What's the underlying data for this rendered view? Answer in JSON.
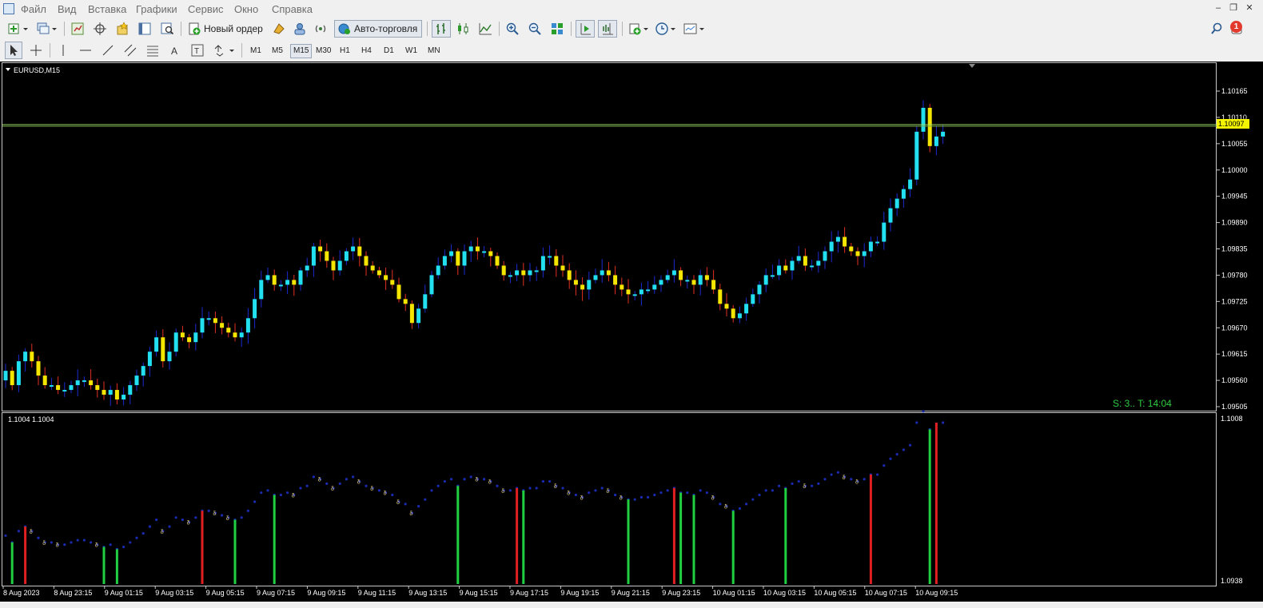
{
  "menu": {
    "items": [
      "Файл",
      "Вид",
      "Вставка",
      "Графики",
      "Сервис",
      "Окно",
      "Справка"
    ]
  },
  "toolbar": {
    "new_order_label": "Новый ордер",
    "autotrade_label": "Авто-торговля",
    "notification_count": "1",
    "timeframes": [
      "M1",
      "M5",
      "M15",
      "M30",
      "H1",
      "H4",
      "D1",
      "W1",
      "MN"
    ],
    "active_timeframe": "M15"
  },
  "chart": {
    "symbol_label": "EURUSD,M15",
    "price_axis_labels": [
      "1.10165",
      "1.10110",
      "1.10055",
      "1.10000",
      "1.09945",
      "1.09890",
      "1.09835",
      "1.09780",
      "1.09725",
      "1.09670",
      "1.09615",
      "1.09560",
      "1.09505"
    ],
    "current_price": "1.10097",
    "status_text": "S: 3..  T: 14:04",
    "indicator_label": "1.1004 1.1004",
    "indicator_axis_top": "1.1008",
    "indicator_axis_bottom": "1.0938",
    "time_labels": [
      "8 Aug 2023",
      "8 Aug 23:15",
      "9 Aug 01:15",
      "9 Aug 03:15",
      "9 Aug 05:15",
      "9 Aug 07:15",
      "9 Aug 09:15",
      "9 Aug 11:15",
      "9 Aug 13:15",
      "9 Aug 15:15",
      "9 Aug 17:15",
      "9 Aug 19:15",
      "9 Aug 21:15",
      "9 Aug 23:15",
      "10 Aug 01:15",
      "10 Aug 03:15",
      "10 Aug 05:15",
      "10 Aug 07:15",
      "10 Aug 09:15"
    ],
    "colors": {
      "up": "#22e0f0",
      "down": "#f5e600",
      "wick_up": "#1a2bd0",
      "wick_down": "#e23020",
      "price_line": "#9ad860",
      "indicator_red": "#e02020",
      "indicator_green": "#20d040",
      "indicator_dots": "#1a2bb0",
      "status_text": "#2ecc40"
    }
  },
  "chart_data": {
    "type": "candlestick",
    "symbol": "EURUSD,M15",
    "ylim": [
      1.09505,
      1.10195
    ],
    "closes": [
      1.0958,
      1.0955,
      1.096,
      1.0962,
      1.096,
      1.0957,
      1.0955,
      1.0955,
      1.0954,
      1.0954,
      1.0955,
      1.0956,
      1.0956,
      1.0955,
      1.0954,
      1.0953,
      1.0954,
      1.0952,
      1.0953,
      1.0955,
      1.0957,
      1.0959,
      1.0962,
      1.0965,
      1.096,
      1.0962,
      1.0966,
      1.0965,
      1.0964,
      1.0966,
      1.0969,
      1.0969,
      1.0968,
      1.0967,
      1.0966,
      1.0965,
      1.0966,
      1.0969,
      1.0973,
      1.0977,
      1.0978,
      1.0976,
      1.0976,
      1.0977,
      1.0976,
      1.0979,
      1.098,
      1.0984,
      1.0983,
      1.0981,
      1.0979,
      1.0981,
      1.0983,
      1.0984,
      1.0982,
      1.098,
      1.0979,
      1.0978,
      1.0977,
      1.0976,
      1.0973,
      1.0972,
      1.0968,
      1.0971,
      1.0974,
      1.0978,
      1.098,
      1.0982,
      1.0983,
      1.098,
      1.0983,
      1.0984,
      1.0983,
      1.0983,
      1.0982,
      1.098,
      1.0978,
      1.0978,
      1.0979,
      1.0978,
      1.0979,
      1.0979,
      1.0982,
      1.0982,
      1.098,
      1.0979,
      1.0977,
      1.0976,
      1.0975,
      1.0977,
      1.0978,
      1.0979,
      1.0978,
      1.0976,
      1.0975,
      1.0974,
      1.0974,
      1.0975,
      1.0975,
      1.0976,
      1.0977,
      1.0978,
      1.0979,
      1.0977,
      1.0977,
      1.0976,
      1.0978,
      1.0977,
      1.0975,
      1.0972,
      1.0971,
      1.0969,
      1.097,
      1.0972,
      1.0974,
      1.0976,
      1.0978,
      1.0978,
      1.098,
      1.0979,
      1.0981,
      1.0982,
      1.098,
      1.098,
      1.0981,
      1.0983,
      1.0985,
      1.0986,
      1.0984,
      1.0983,
      1.0982,
      1.0983,
      1.0985,
      1.0985,
      1.0989,
      1.0992,
      1.0994,
      1.0996,
      1.0998,
      1.1008,
      1.1013,
      1.1005,
      1.1007,
      1.1008
    ]
  }
}
